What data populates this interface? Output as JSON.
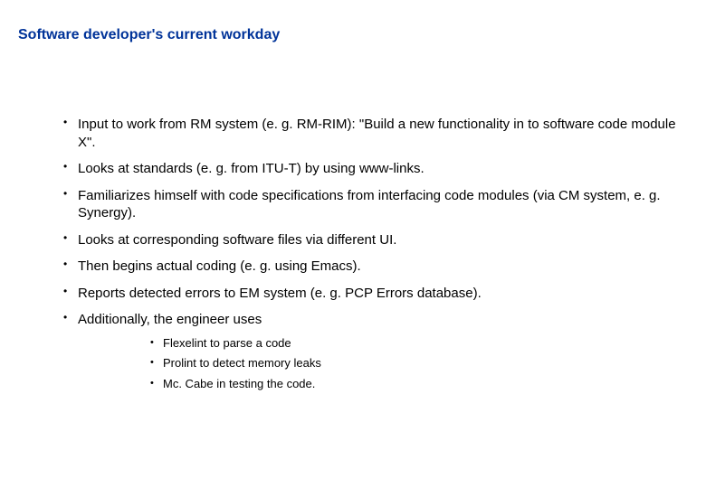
{
  "title": "Software developer's current workday",
  "bullets": {
    "b0": "Input to work from RM system (e. g. RM-RIM): \"Build a new functionality in to software code module X\".",
    "b1": "Looks at standards (e. g. from ITU-T) by using www-links.",
    "b2": "Familiarizes himself with code specifications from interfacing code modules (via CM system, e. g. Synergy).",
    "b3": "Looks at corresponding software files via different UI.",
    "b4": "Then begins actual coding (e. g. using Emacs).",
    "b5": "Reports detected errors to EM system (e. g. PCP Errors database).",
    "b6": "Additionally, the engineer uses"
  },
  "sub": {
    "s0": "Flexelint to parse a code",
    "s1": "Prolint to detect memory leaks",
    "s2": "Mc. Cabe in testing the code."
  }
}
